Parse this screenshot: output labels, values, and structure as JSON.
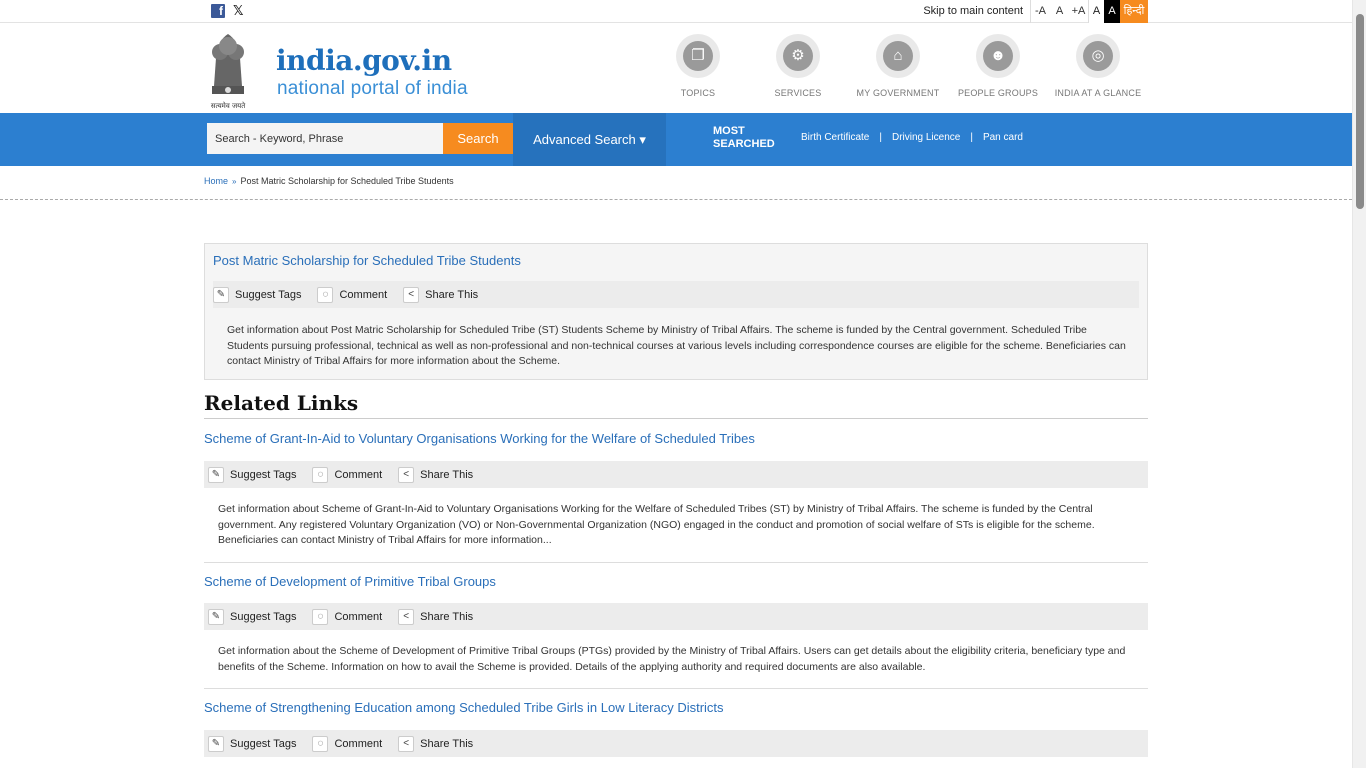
{
  "topbar": {
    "facebook_icon": "f",
    "x_icon": "𝕏",
    "skip": "Skip to main content",
    "font_minus": "-A",
    "font_normal": "A",
    "font_plus": "+A",
    "contrast_white": "A",
    "contrast_black": "A",
    "hindi": "हिन्दी"
  },
  "header": {
    "logo_title": "india.gov.in",
    "logo_sub": "national portal of india",
    "emblem_motto": "सत्यमेव जयते",
    "nav": [
      {
        "label": "TOPICS",
        "icon": "topics-icon"
      },
      {
        "label": "SERVICES",
        "icon": "services-icon"
      },
      {
        "label": "MY GOVERNMENT",
        "icon": "government-icon"
      },
      {
        "label": "PEOPLE GROUPS",
        "icon": "people-icon"
      },
      {
        "label": "INDIA AT A GLANCE",
        "icon": "glance-icon"
      }
    ]
  },
  "search": {
    "placeholder": "Search - Keyword, Phrase",
    "button": "Search",
    "advanced": "Advanced Search ▾",
    "most_line1": "MOST",
    "most_line2": "SEARCHED",
    "links": [
      "Birth Certificate",
      "Driving Licence",
      "Pan card"
    ],
    "separator": "|"
  },
  "breadcrumb": {
    "home": "Home",
    "current": "Post Matric Scholarship for Scheduled Tribe Students"
  },
  "actions": {
    "suggest": "Suggest Tags",
    "comment": "Comment",
    "share": "Share This"
  },
  "main": {
    "title": "Post Matric Scholarship for Scheduled Tribe Students",
    "desc": "Get information about Post Matric Scholarship for Scheduled Tribe (ST) Students Scheme by Ministry of Tribal Affairs. The scheme is funded by the Central government. Scheduled Tribe Students pursuing professional, technical as well as non-professional and non-technical courses at various levels including correspondence courses are eligible for the scheme. Beneficiaries can contact Ministry of Tribal Affairs for more information about the Scheme."
  },
  "related": {
    "heading": "Related Links",
    "items": [
      {
        "title": "Scheme of Grant-In-Aid to Voluntary Organisations Working for the Welfare of Scheduled Tribes",
        "desc": "Get information about Scheme of Grant-In-Aid to Voluntary Organisations Working for the Welfare of Scheduled Tribes (ST) by Ministry of Tribal Affairs. The scheme is funded by the Central government. Any registered Voluntary Organization (VO) or Non-Governmental Organization (NGO) engaged in the conduct and promotion of social welfare of STs is eligible for the scheme. Beneficiaries can contact Ministry of Tribal Affairs for more information..."
      },
      {
        "title": "Scheme of Development of Primitive Tribal Groups",
        "desc": "Get information about the Scheme of Development of Primitive Tribal Groups (PTGs) provided by the Ministry of Tribal Affairs. Users can get details about the eligibility criteria, beneficiary type and benefits of the Scheme. Information on how to avail the Scheme is provided. Details of the applying authority and required documents are also available."
      },
      {
        "title": "Scheme of Strengthening Education among Scheduled Tribe Girls in Low Literacy Districts",
        "desc": ""
      }
    ]
  }
}
